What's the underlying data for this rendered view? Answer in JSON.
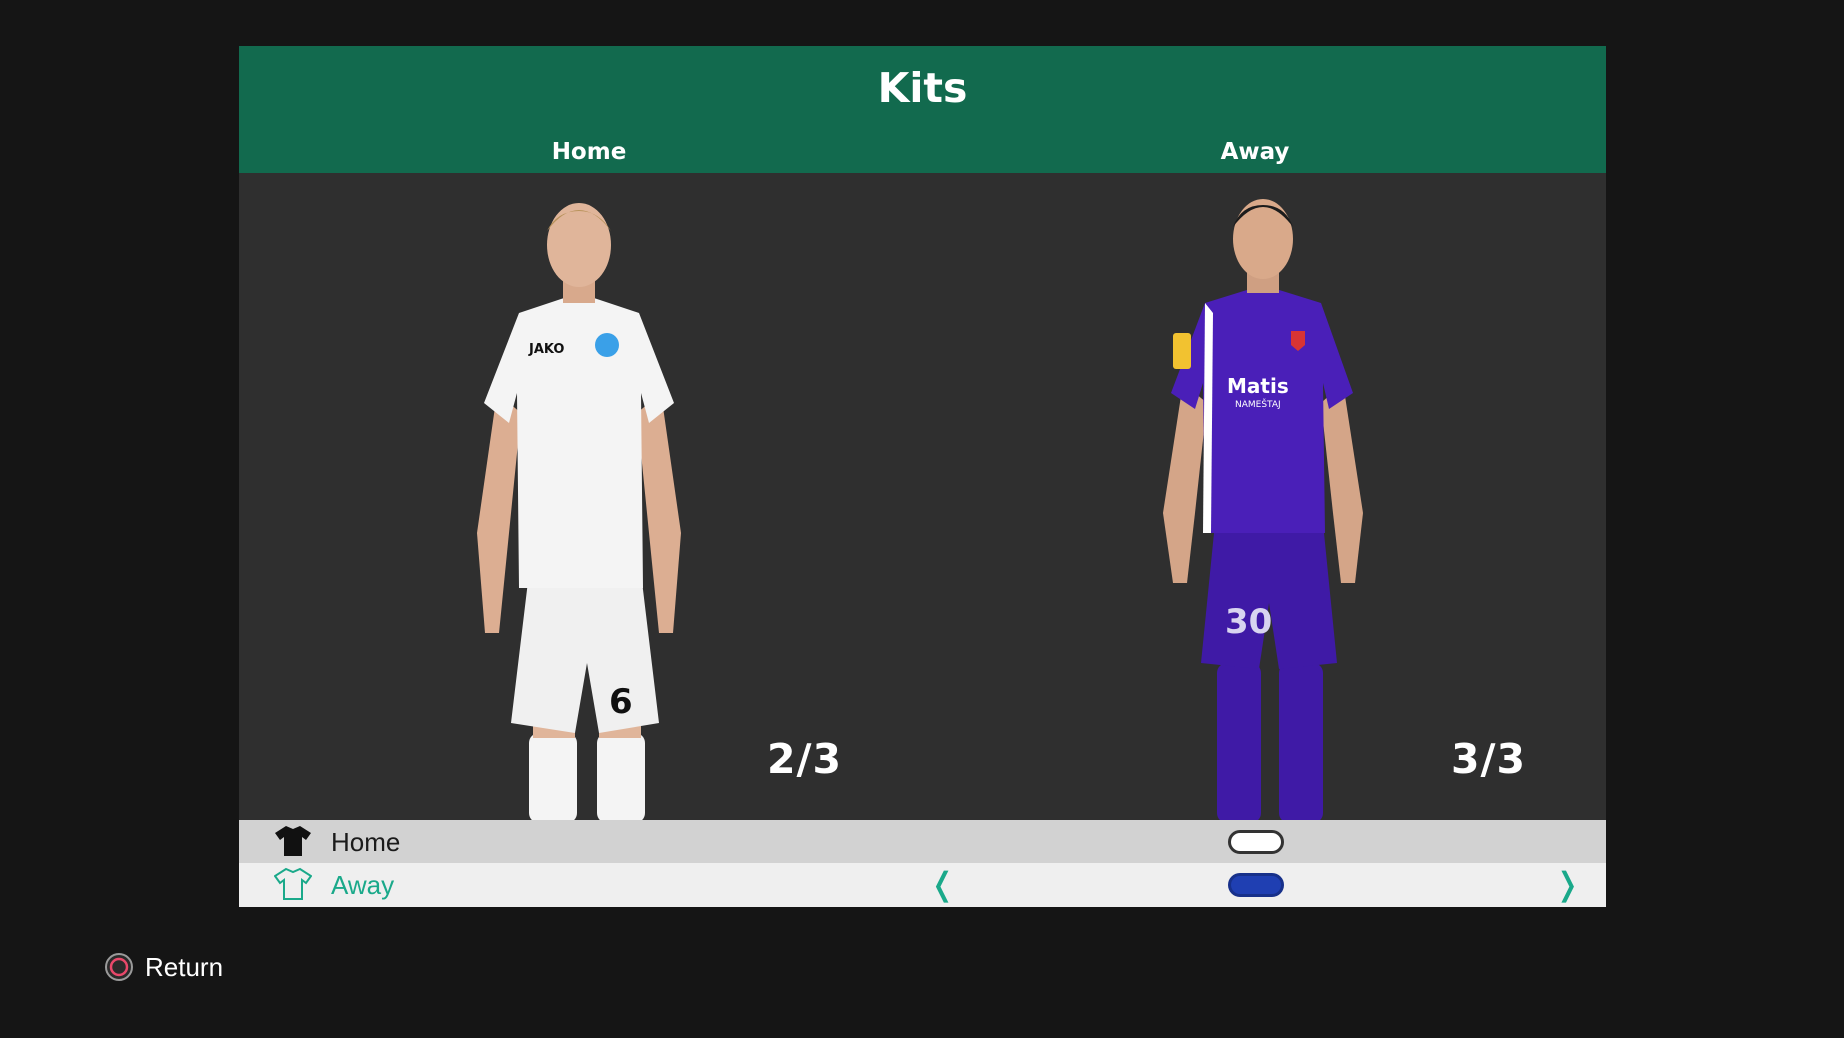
{
  "header": {
    "title": "Kits",
    "columns": [
      "Home",
      "Away"
    ]
  },
  "kits": [
    {
      "label": "Home",
      "counter": "2/3",
      "shirt_color": "#f4f4f4",
      "shorts_color": "#f0f0f0",
      "socks_color": "#f4f4f4",
      "shirt_number": "6",
      "brand": "JAKO"
    },
    {
      "label": "Away",
      "counter": "3/3",
      "shirt_color": "#4a1fb8",
      "shorts_color": "#3f1aa6",
      "socks_color": "#3f1aa6",
      "shirt_number": "30",
      "sponsor": "Matis",
      "sponsor_sub": "NAMEŠTAJ"
    }
  ],
  "selector": {
    "rows": [
      {
        "label": "Home",
        "icon": "shirt-filled-icon",
        "swatch_color": "#ffffff"
      },
      {
        "label": "Away",
        "icon": "shirt-outline-icon",
        "swatch_color": "#1f3fb2",
        "selected": true
      }
    ],
    "prev_arrow": "❬",
    "next_arrow": "❭"
  },
  "footer": {
    "return_label": "Return",
    "button_icon": "circle-button-icon"
  },
  "colors": {
    "header_green": "#126a4e",
    "accent_teal": "#1aa98a",
    "stage_gray": "#2f2f2f"
  }
}
